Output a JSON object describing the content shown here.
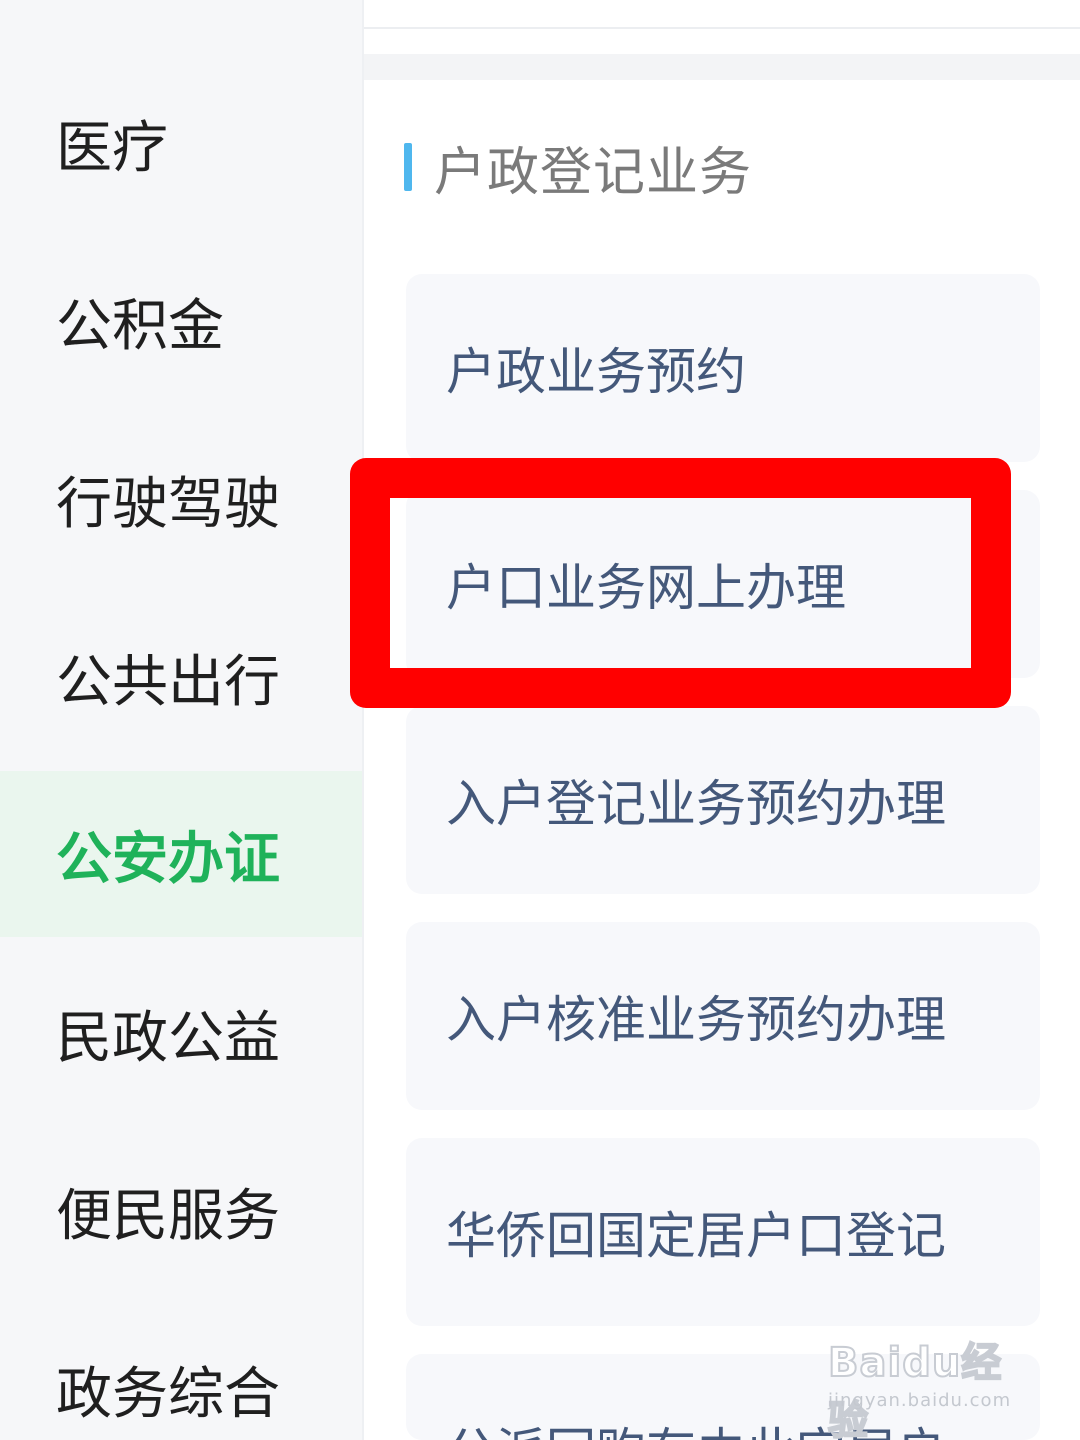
{
  "sidebar": {
    "items": [
      {
        "label": "医疗"
      },
      {
        "label": "公积金"
      },
      {
        "label": "行驶驾驶"
      },
      {
        "label": "公共出行"
      },
      {
        "label": "公安办证",
        "active": true
      },
      {
        "label": "民政公益"
      },
      {
        "label": "便民服务"
      },
      {
        "label": "政务综合"
      }
    ]
  },
  "main": {
    "section_title": "户政登记业务",
    "services": [
      {
        "label": "户政业务预约"
      },
      {
        "label": "户口业务网上办理",
        "highlighted": true
      },
      {
        "label": "入户登记业务预约办理"
      },
      {
        "label": "入户核准业务预约办理"
      },
      {
        "label": "华侨回国定居户口登记"
      },
      {
        "label": "公派回购存由此定居户"
      }
    ]
  },
  "watermark": {
    "brand": "Baidu经验",
    "url": "jingyan.baidu.com"
  },
  "colors": {
    "accent_green": "#1fb25a",
    "section_bar": "#4fb7ee",
    "highlight_red": "#ff0000",
    "service_text": "#44587a"
  }
}
